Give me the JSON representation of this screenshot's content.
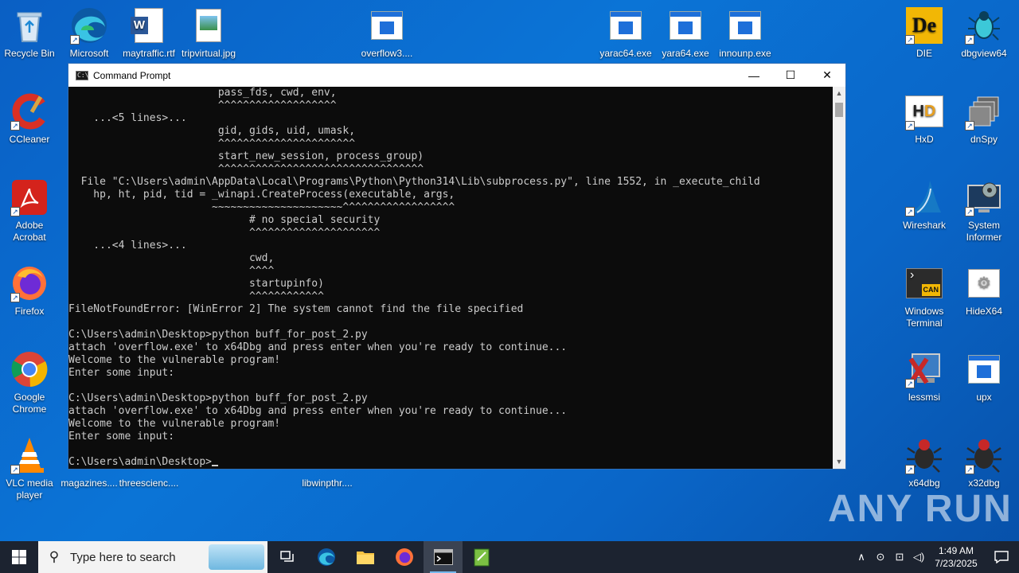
{
  "desktop_icons": {
    "recycle_bin": "Recycle Bin",
    "edge": "Microsoft Edge",
    "maytraffic": "maytraffic.rtf",
    "tripvirtual": "tripvirtual.jpg",
    "overflow3": "overflow3....",
    "yarac64": "yarac64.exe",
    "yara64": "yara64.exe",
    "innounp": "innounp.exe",
    "die": "DIE",
    "dbgview64": "dbgview64",
    "ccleaner": "CCleaner",
    "hxd": "HxD",
    "dnspy": "dnSpy",
    "adobe": "Adobe Acrobat",
    "wireshark": "Wireshark",
    "system_informer": "System Informer",
    "firefox": "Firefox",
    "windows_terminal": "Windows Terminal",
    "hidex64": "HideX64",
    "chrome": "Google Chrome",
    "lessmsi": "lessmsi",
    "upx": "upx",
    "vlc": "VLC media player",
    "magazines": "magazines....",
    "threescience": "threescienc....",
    "libwinpthr": "libwinpthr....",
    "x64dbg": "x64dbg",
    "x32dbg": "x32dbg"
  },
  "window": {
    "title": "Command Prompt",
    "minimize": "—",
    "maximize": "☐",
    "close": "✕"
  },
  "console": {
    "lines": [
      "                        pass_fds, cwd, env,",
      "                        ^^^^^^^^^^^^^^^^^^^",
      "    ...<5 lines>...",
      "                        gid, gids, uid, umask,",
      "                        ^^^^^^^^^^^^^^^^^^^^^^",
      "                        start_new_session, process_group)",
      "                        ^^^^^^^^^^^^^^^^^^^^^^^^^^^^^^^^^",
      "  File \"C:\\Users\\admin\\AppData\\Local\\Programs\\Python\\Python314\\Lib\\subprocess.py\", line 1552, in _execute_child",
      "    hp, ht, pid, tid = _winapi.CreateProcess(executable, args,",
      "                       ~~~~~~~~~~~~~~~~~~~~~^^^^^^^^^^^^^^^^^^",
      "                             # no special security",
      "                             ^^^^^^^^^^^^^^^^^^^^^",
      "    ...<4 lines>...",
      "                             cwd,",
      "                             ^^^^",
      "                             startupinfo)",
      "                             ^^^^^^^^^^^^",
      "FileNotFoundError: [WinError 2] The system cannot find the file specified",
      "",
      "C:\\Users\\admin\\Desktop>python buff_for_post_2.py",
      "attach 'overflow.exe' to x64Dbg and press enter when you're ready to continue...",
      "Welcome to the vulnerable program!",
      "Enter some input:",
      "",
      "C:\\Users\\admin\\Desktop>python buff_for_post_2.py",
      "attach 'overflow.exe' to x64Dbg and press enter when you're ready to continue...",
      "Welcome to the vulnerable program!",
      "Enter some input:",
      ""
    ],
    "prompt": "C:\\Users\\admin\\Desktop>"
  },
  "taskbar": {
    "search_placeholder": "Type here to search",
    "time": "1:49 AM",
    "date": "7/23/2025"
  },
  "watermark": "ANY RUN",
  "colors": {
    "desktop": "#0b74d6",
    "console_bg": "#0c0c0c",
    "console_fg": "#cccccc",
    "taskbar": "#1c2330"
  }
}
